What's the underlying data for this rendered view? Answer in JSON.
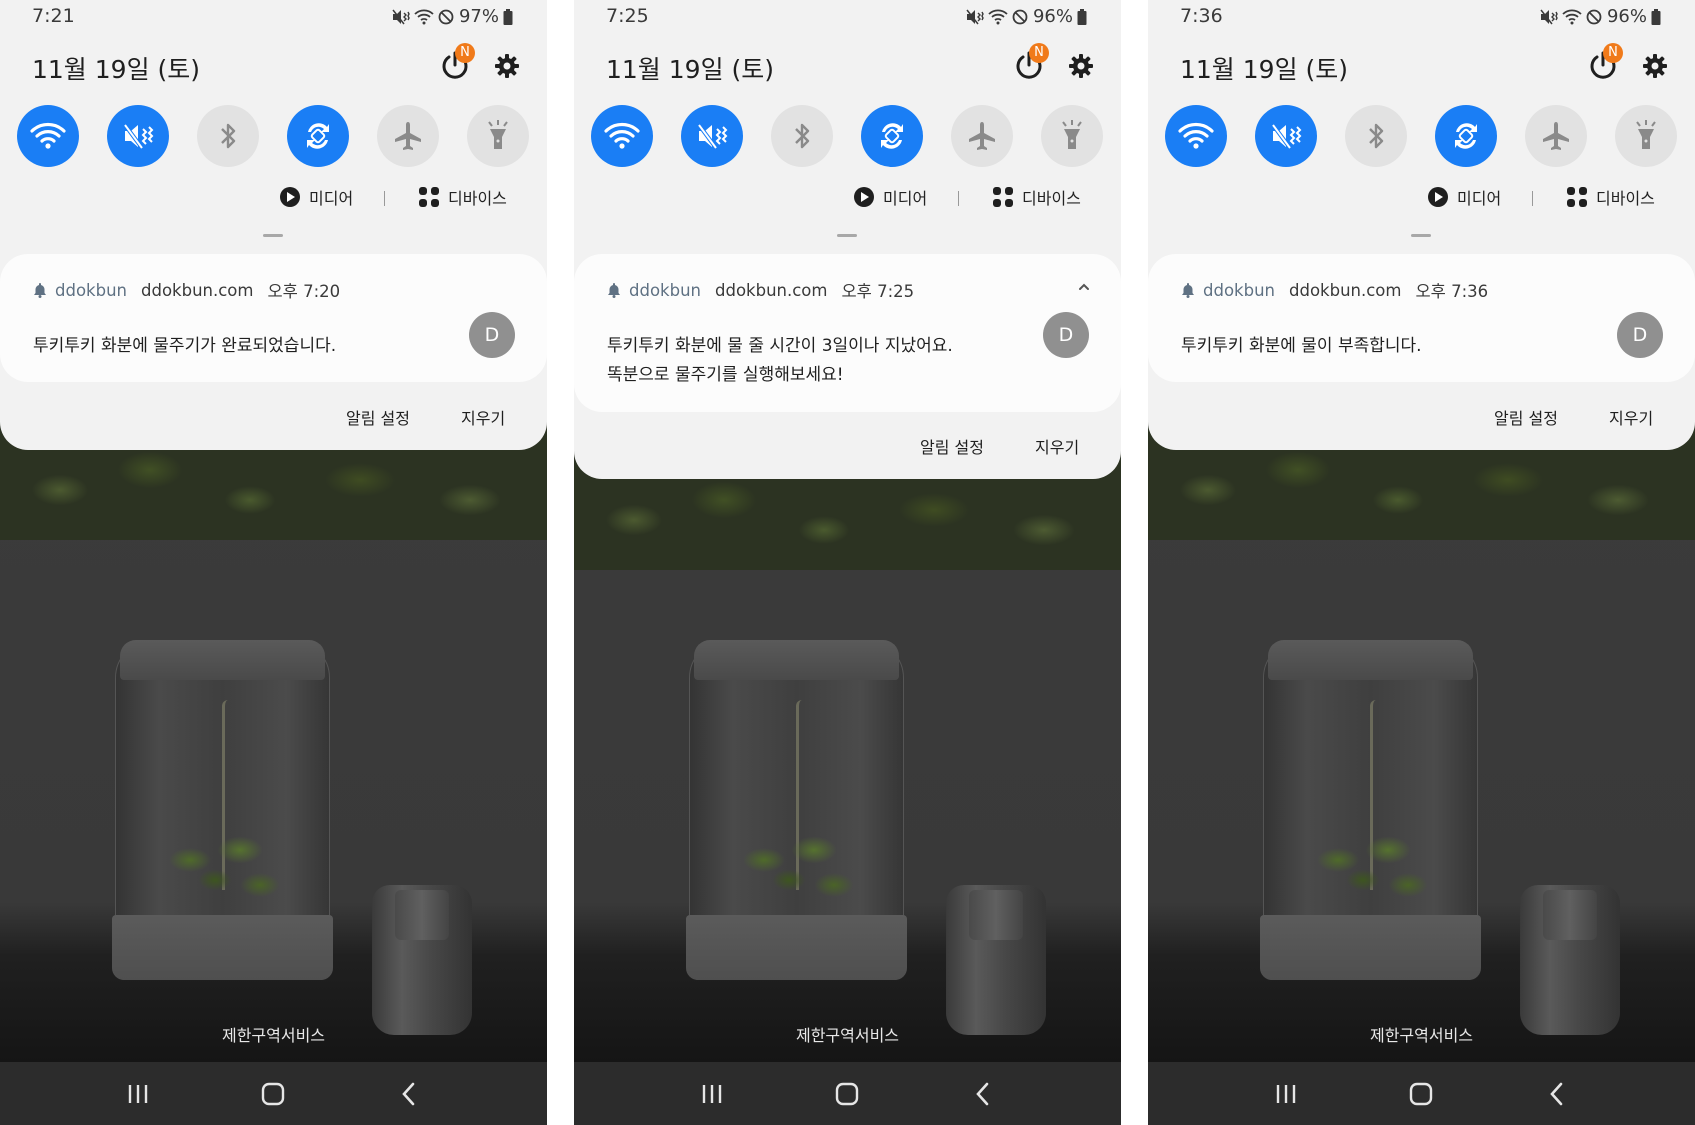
{
  "screens": [
    {
      "status": {
        "time": "7:21",
        "battery": "97%"
      },
      "date": "11월 19일 (토)",
      "power_badge": "N",
      "media_label": "미디어",
      "devices_label": "디바이스",
      "notification": {
        "app": "ddokbun",
        "host": "ddokbun.com",
        "time": "오후 7:20",
        "avatar": "D",
        "body": "투키투키 화분에 물주기가 완료되었습니다.",
        "expanded": false
      },
      "actions": {
        "settings": "알림 설정",
        "clear": "지우기"
      },
      "restricted_label": "제한구역서비스"
    },
    {
      "status": {
        "time": "7:25",
        "battery": "96%"
      },
      "date": "11월 19일 (토)",
      "power_badge": "N",
      "media_label": "미디어",
      "devices_label": "디바이스",
      "notification": {
        "app": "ddokbun",
        "host": "ddokbun.com",
        "time": "오후 7:25",
        "avatar": "D",
        "body": "투키투키 화분에 물 줄 시간이 3일이나 지났어요.\n똑분으로 물주기를 실행해보세요!",
        "expanded": true
      },
      "actions": {
        "settings": "알림 설정",
        "clear": "지우기"
      },
      "restricted_label": "제한구역서비스"
    },
    {
      "status": {
        "time": "7:36",
        "battery": "96%"
      },
      "date": "11월 19일 (토)",
      "power_badge": "N",
      "media_label": "미디어",
      "devices_label": "디바이스",
      "notification": {
        "app": "ddokbun",
        "host": "ddokbun.com",
        "time": "오후 7:36",
        "avatar": "D",
        "body": "투키투키 화분에 물이 부족합니다.",
        "expanded": false
      },
      "actions": {
        "settings": "알림 설정",
        "clear": "지우기"
      },
      "restricted_label": "제한구역서비스"
    }
  ],
  "quick_toggles": [
    {
      "name": "wifi",
      "on": true
    },
    {
      "name": "sound-mute",
      "on": true
    },
    {
      "name": "bluetooth",
      "on": false
    },
    {
      "name": "auto-rotate",
      "on": true
    },
    {
      "name": "airplane-mode",
      "on": false
    },
    {
      "name": "flashlight",
      "on": false
    }
  ],
  "colors": {
    "accent": "#1a7ef5",
    "badge": "#f07a1a",
    "panel": "#f2f2f2",
    "card": "#fcfcfc"
  }
}
